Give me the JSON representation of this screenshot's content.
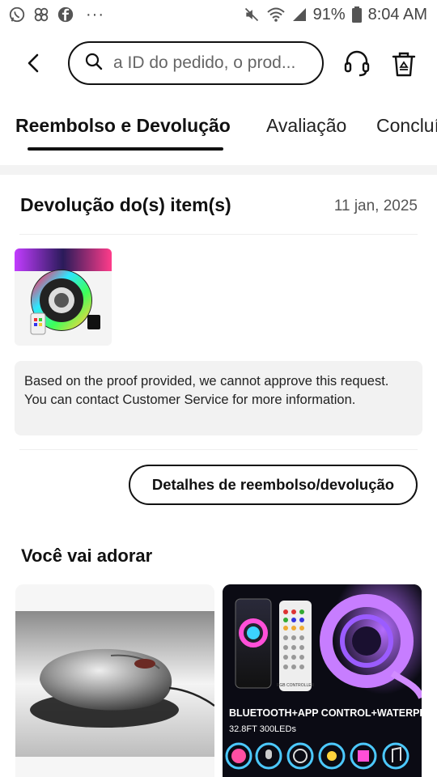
{
  "status_bar": {
    "battery": "91%",
    "time": "8:04 AM"
  },
  "search": {
    "placeholder": "a ID do pedido, o prod..."
  },
  "tabs": [
    {
      "label": "Reembolso e Devolução",
      "active": true
    },
    {
      "label": "Avaliação",
      "active": false
    },
    {
      "label": "Concluí",
      "active": false
    }
  ],
  "return_section": {
    "title": "Devolução do(s) item(s)",
    "date": "11 jan, 2025",
    "notice": "Based on the proof provided, we cannot approve this request. You can contact Customer Service for more information.",
    "details_button": "Detalhes de reembolso/devolução"
  },
  "recommendations": {
    "title": "Você vai adorar",
    "products": [
      {
        "image": "computer-mouse-photo"
      },
      {
        "image": "rgb-led-strip-photo",
        "banner_text": "BLUETOOTH+APP CONTROL+WATERPROOF",
        "spec_text": "32.8FT  300LEDs",
        "remote_caption": "RGB CONTROLLER"
      }
    ]
  },
  "colors": {
    "text_primary": "#111111",
    "notice_bg": "#f2f2f2"
  }
}
